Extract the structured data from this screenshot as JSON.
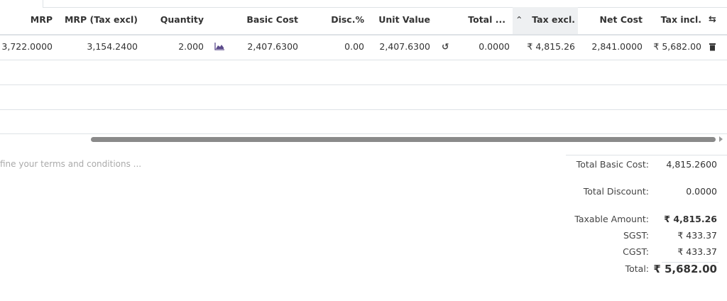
{
  "table": {
    "columns": [
      "MRP",
      "MRP (Tax excl)",
      "Quantity",
      "Basic Cost",
      "Disc.%",
      "Unit Value",
      "Total ...",
      "Tax excl.",
      "Net Cost",
      "Tax incl."
    ],
    "rows": [
      {
        "mrp": "3,722.0000",
        "mrp_tax_excl": "3,154.2400",
        "quantity": "2.000",
        "basic_cost": "2,407.6300",
        "disc": "0.00",
        "unit_value": "2,407.6300",
        "total": "0.0000",
        "tax_excl": "₹ 4,815.26",
        "net_cost": "2,841.0000",
        "tax_incl": "₹ 5,682.00"
      }
    ],
    "icons": {
      "forecast": "area-chart-icon",
      "reset": "undo-icon",
      "sort": "chevron-up-icon",
      "settings": "column-settings-icon",
      "delete": "trash-icon"
    }
  },
  "terms": {
    "placeholder": "fine your terms and conditions ..."
  },
  "summary": {
    "total_basic_cost_label": "Total Basic Cost:",
    "total_basic_cost": "4,815.2600",
    "total_discount_label": "Total Discount:",
    "total_discount": "0.0000",
    "taxable_amount_label": "Taxable Amount:",
    "taxable_amount": "₹ 4,815.26",
    "sgst_label": "SGST:",
    "sgst": "₹ 433.37",
    "cgst_label": "CGST:",
    "cgst": "₹ 433.37",
    "total_label": "Total:",
    "total": "₹ 5,682.00"
  },
  "colors": {
    "accent": "#714b67",
    "chart_icon": "#5b4a8b"
  }
}
